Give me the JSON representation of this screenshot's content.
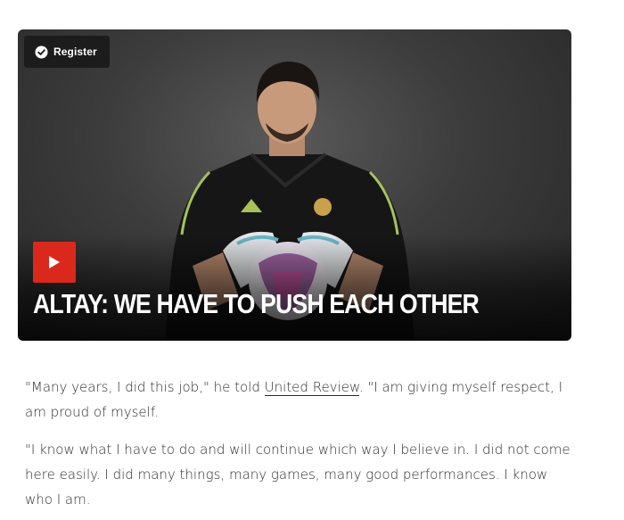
{
  "video": {
    "register_label": "Register",
    "title": "ALTAY: WE HAVE TO PUSH EACH OTHER"
  },
  "article": {
    "p1_before": "\"Many years, I did this job,\" he told ",
    "p1_link": "United Review",
    "p1_after": ". \"I am giving myself respect, I am proud of myself.",
    "p2": "\"I know what I have to do and will continue which way I believe in. I did not come here easily. I did many things, many games, many good performances. I know who I am."
  },
  "colors": {
    "play_red": "#da291c",
    "badge_bg": "#1c1c1c",
    "text": "#2e2e2e"
  },
  "icons": {
    "badge": "check-circle-icon",
    "play": "play-icon"
  }
}
